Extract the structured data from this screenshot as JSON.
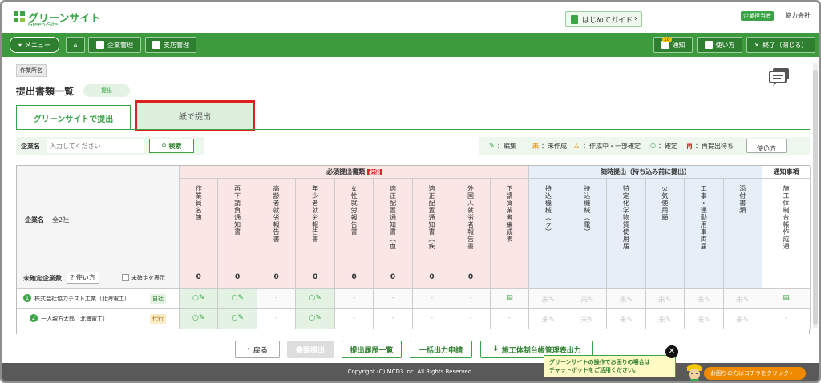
{
  "header": {
    "logo_name": "グリーンサイト",
    "logo_sub": "Green-Site",
    "guide_label": "はじめてガイド",
    "role_badge": "企業担当者",
    "company": "協力会社"
  },
  "nav": {
    "menu": "メニュー",
    "company_mgmt": "企業管理",
    "branch_mgmt": "支店管理",
    "notice_label": "通知",
    "notice_count": "10",
    "howto": "使い方",
    "exit": "終了（閉じる）"
  },
  "page": {
    "breadcrumb": "作業所名",
    "title": "提出書類一覧",
    "title_status": "提出",
    "tabs": [
      "グリーンサイトで提出",
      "紙で提出"
    ]
  },
  "filter": {
    "label": "企業名",
    "placeholder": "入力してください",
    "search": "検索"
  },
  "legend": {
    "edit": "：編集",
    "not_created_mark": "未",
    "not_created": "：未作成",
    "partial": "：作成中・一部確定",
    "confirmed": "：確定",
    "resubmit_mark": "再",
    "resubmit": "：再提出待ち",
    "help": "使い方"
  },
  "table": {
    "group_required": "必須提出書類",
    "required_badge": "必須",
    "group_optional": "随時提出（持ち込み前に提出）",
    "group_notice": "通知事項",
    "company_label": "企業名",
    "company_total": "全2社",
    "unconfirmed_label": "未確定企業数",
    "unconfirmed_help": "使い方",
    "show_unconfirmed": "未確定を表示",
    "columns": [
      {
        "label": "作業員名簿",
        "group": "required",
        "count": "0"
      },
      {
        "label": "再下請負通知書",
        "group": "required",
        "count": "0"
      },
      {
        "label": "高齢者就労報告書",
        "group": "required",
        "count": "0"
      },
      {
        "label": "年少者就労報告書",
        "group": "required",
        "count": "0"
      },
      {
        "label": "女性就労報告書",
        "group": "required",
        "count": "0"
      },
      {
        "label": "適正配置通知書（血…",
        "group": "required",
        "count": "0"
      },
      {
        "label": "適正配置通知書（疾…",
        "group": "required",
        "count": "0"
      },
      {
        "label": "外国人就労者報告書",
        "group": "required",
        "count": "0"
      },
      {
        "label": "下請負業者編成表",
        "group": "required",
        "count": ""
      },
      {
        "label": "持込機械（ク）",
        "group": "optional",
        "count": ""
      },
      {
        "label": "持込機械（電）",
        "group": "optional",
        "count": ""
      },
      {
        "label": "特定化学物質使用届",
        "group": "optional",
        "count": ""
      },
      {
        "label": "火気使用願",
        "group": "optional",
        "count": ""
      },
      {
        "label": "工事・通勤用車両届",
        "group": "optional",
        "count": ""
      },
      {
        "label": "添付書類",
        "group": "optional",
        "count": ""
      },
      {
        "label": "施工体制台帳作成通知",
        "group": "notice",
        "count": ""
      }
    ],
    "rows": [
      {
        "num": "1",
        "name": "株式会社協力テスト工業（北海電工）",
        "tag": "自社",
        "cells": [
          "○✎",
          "○✎",
          "-",
          "○✎",
          "-",
          "-",
          "-",
          "-",
          "doc",
          "未✎",
          "未✎",
          "未✎",
          "未✎",
          "未✎",
          "未✎",
          "doc"
        ]
      },
      {
        "num": "2",
        "name": "一人親方太郎（北海電工）",
        "tag": "代行",
        "cells": [
          "○✎",
          "○✎",
          "-",
          "○✎",
          "-",
          "-",
          "-",
          "-",
          "-",
          "未✎",
          "未✎",
          "未✎",
          "未✎",
          "未✎",
          "未✎",
          "-"
        ]
      }
    ]
  },
  "footer": {
    "back": "戻る",
    "submit": "書類提出",
    "history": "提出履歴一覧",
    "bulk": "一括出力申請",
    "ledger": "施工体制台帳管理表出力",
    "copyright": "Copyright (C) MCD3 Inc. All Rights Reserved.",
    "chat_help": "グリーンサイトの操作でお困りの場合は\nチャットボットをご活用ください。",
    "trouble": "お困りの方はコチラをクリック"
  },
  "colors": {
    "brand_green": "#3aa447",
    "nav_green": "#3d9a3d",
    "required_bg": "#fbe6e6",
    "optional_bg": "#e6eef7",
    "highlight_red": "#e02020"
  }
}
